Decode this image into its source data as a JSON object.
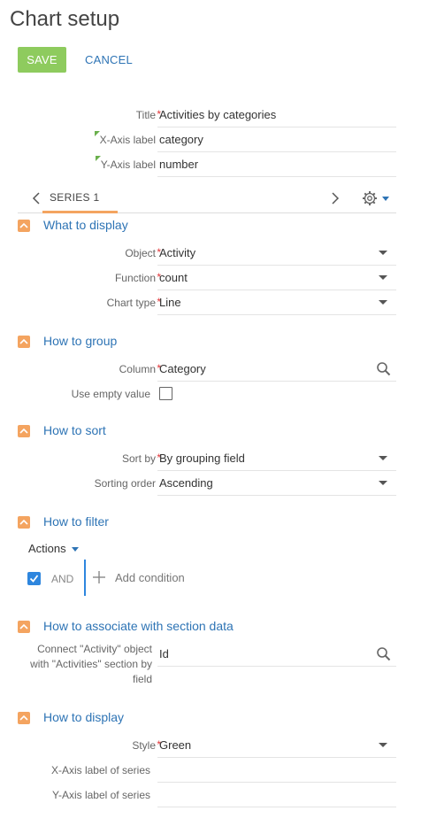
{
  "page": {
    "title": "Chart setup"
  },
  "toolbar": {
    "save_label": "SAVE",
    "cancel_label": "CANCEL"
  },
  "general": {
    "title_label": "Title",
    "title_value": "Activities by categories",
    "xaxis_label": "X-Axis label",
    "xaxis_value": "category",
    "yaxis_label": "Y-Axis label",
    "yaxis_value": "number"
  },
  "series_tabs": {
    "current": "SERIES 1"
  },
  "what_to_display": {
    "section_title": "What to display",
    "object_label": "Object",
    "object_value": "Activity",
    "function_label": "Function",
    "function_value": "count",
    "chart_type_label": "Chart type",
    "chart_type_value": "Line"
  },
  "how_to_group": {
    "section_title": "How to group",
    "column_label": "Column",
    "column_value": "Category",
    "use_empty_label": "Use empty value",
    "use_empty_checked": false
  },
  "how_to_sort": {
    "section_title": "How to sort",
    "sort_by_label": "Sort by",
    "sort_by_value": "By grouping field",
    "order_label": "Sorting order",
    "order_value": "Ascending"
  },
  "how_to_filter": {
    "section_title": "How to filter",
    "actions_label": "Actions",
    "and_label": "AND",
    "add_condition_label": "Add condition"
  },
  "how_to_associate": {
    "section_title": "How to associate with section data",
    "connect_label_1": "Connect \"Activity\" object",
    "connect_label_2": "with \"Activities\" section by",
    "connect_label_3": "field",
    "connect_value": "Id"
  },
  "how_to_display": {
    "section_title": "How to display",
    "style_label": "Style",
    "style_value": "Green",
    "x_series_label": "X-Axis label of series",
    "x_series_value": "",
    "y_series_label": "Y-Axis label of series",
    "y_series_value": ""
  },
  "colors": {
    "accent": "#2e74b5",
    "save": "#8ecb5e",
    "section_chevron": "#f4a460",
    "required": "#e0373a"
  }
}
